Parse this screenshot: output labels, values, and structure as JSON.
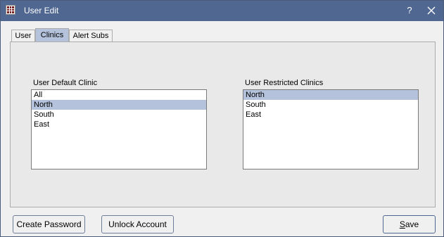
{
  "window": {
    "title": "User Edit",
    "help_label": "?"
  },
  "tabs": [
    {
      "label": "User"
    },
    {
      "label": "Clinics"
    },
    {
      "label": "Alert Subs"
    }
  ],
  "default_clinic": {
    "label": "User Default Clinic",
    "items": [
      "All",
      "North",
      "South",
      "East"
    ],
    "selected": "North"
  },
  "restricted_clinics": {
    "label": "User Restricted Clinics",
    "items": [
      "North",
      "South",
      "East"
    ],
    "selected": "North"
  },
  "buttons": {
    "create_password": "Create Password",
    "unlock_account": "Unlock Account",
    "save_underline": "S",
    "save_rest": "ave"
  },
  "colors": {
    "titlebar": "#4f6791",
    "selection": "#b4c2dc"
  }
}
